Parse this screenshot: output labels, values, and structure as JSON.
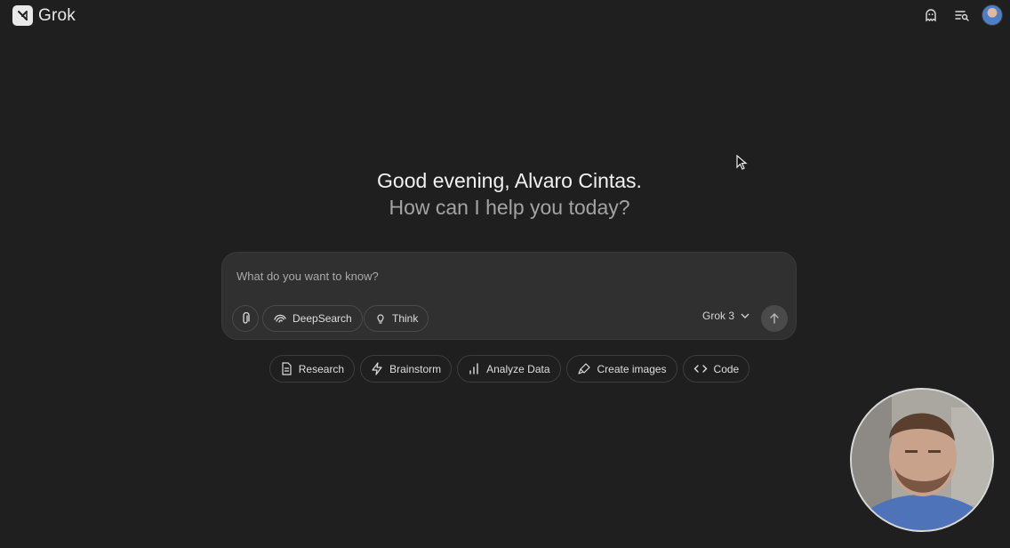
{
  "app": {
    "name": "Grok"
  },
  "header": {
    "icons": [
      "ghost-icon",
      "history-search-icon",
      "avatar"
    ]
  },
  "greeting": {
    "line1": "Good evening, Alvaro Cintas.",
    "line2": "How can I help you today?"
  },
  "composer": {
    "placeholder": "What do you want to know?",
    "deepsearch_label": "DeepSearch",
    "think_label": "Think",
    "model_label": "Grok 3"
  },
  "suggestions": [
    {
      "label": "Research",
      "icon": "document-icon"
    },
    {
      "label": "Brainstorm",
      "icon": "lightning-icon"
    },
    {
      "label": "Analyze Data",
      "icon": "bar-chart-icon"
    },
    {
      "label": "Create images",
      "icon": "paint-brush-icon"
    },
    {
      "label": "Code",
      "icon": "code-icon"
    }
  ],
  "colors": {
    "background": "#1f1f1f",
    "composer": "#303030",
    "text_primary": "#f1f1f1",
    "text_secondary": "#a3a3a3"
  }
}
